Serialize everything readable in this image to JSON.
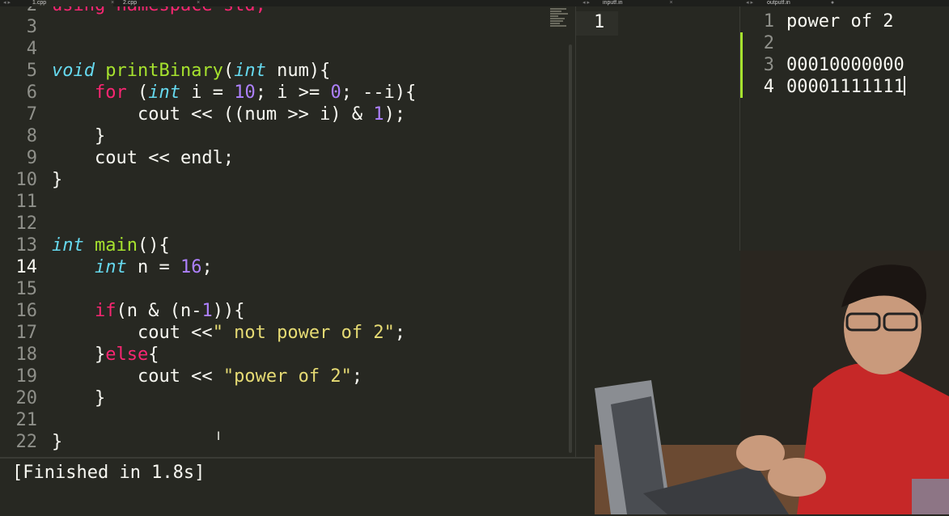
{
  "tabs": {
    "main": [
      {
        "label": "1.cpp",
        "active": true
      },
      {
        "label": "2.cpp",
        "active": false
      }
    ],
    "input": {
      "label": "inputf.in"
    },
    "output": {
      "label": "outputf.in"
    }
  },
  "editor": {
    "lines": [
      {
        "n": "2",
        "tokens": [
          {
            "t": "using namespace std;",
            "c": "kw-partial"
          }
        ]
      },
      {
        "n": "3",
        "tokens": []
      },
      {
        "n": "4",
        "tokens": []
      },
      {
        "n": "5",
        "tokens": [
          {
            "t": "void",
            "c": "ty"
          },
          {
            "t": " "
          },
          {
            "t": "printBinary",
            "c": "fn"
          },
          {
            "t": "("
          },
          {
            "t": "int",
            "c": "ty"
          },
          {
            "t": " num){"
          }
        ]
      },
      {
        "n": "6",
        "tokens": [
          {
            "t": "    "
          },
          {
            "t": "for",
            "c": "kw"
          },
          {
            "t": " ("
          },
          {
            "t": "int",
            "c": "ty"
          },
          {
            "t": " i = "
          },
          {
            "t": "10",
            "c": "num"
          },
          {
            "t": "; i >= "
          },
          {
            "t": "0",
            "c": "num"
          },
          {
            "t": "; --i){"
          }
        ]
      },
      {
        "n": "7",
        "tokens": [
          {
            "t": "        cout << ((num >> i) & "
          },
          {
            "t": "1",
            "c": "num"
          },
          {
            "t": ");"
          }
        ]
      },
      {
        "n": "8",
        "tokens": [
          {
            "t": "    }"
          }
        ]
      },
      {
        "n": "9",
        "tokens": [
          {
            "t": "    cout << endl;"
          }
        ]
      },
      {
        "n": "10",
        "tokens": [
          {
            "t": "}"
          }
        ]
      },
      {
        "n": "11",
        "tokens": []
      },
      {
        "n": "12",
        "tokens": []
      },
      {
        "n": "13",
        "tokens": [
          {
            "t": "int",
            "c": "ty"
          },
          {
            "t": " "
          },
          {
            "t": "main",
            "c": "fn"
          },
          {
            "t": "(){"
          }
        ]
      },
      {
        "n": "14",
        "tokens": [
          {
            "t": "    "
          },
          {
            "t": "int",
            "c": "ty"
          },
          {
            "t": " n = "
          },
          {
            "t": "16",
            "c": "num"
          },
          {
            "t": ";"
          }
        ],
        "current": true
      },
      {
        "n": "15",
        "tokens": []
      },
      {
        "n": "16",
        "tokens": [
          {
            "t": "    "
          },
          {
            "t": "if",
            "c": "kw"
          },
          {
            "t": "(n & (n-"
          },
          {
            "t": "1",
            "c": "num"
          },
          {
            "t": ")){"
          }
        ]
      },
      {
        "n": "17",
        "tokens": [
          {
            "t": "        cout <<"
          },
          {
            "t": "\" not power of 2\"",
            "c": "str"
          },
          {
            "t": ";"
          }
        ]
      },
      {
        "n": "18",
        "tokens": [
          {
            "t": "    }"
          },
          {
            "t": "else",
            "c": "kw"
          },
          {
            "t": "{"
          }
        ]
      },
      {
        "n": "19",
        "tokens": [
          {
            "t": "        cout << "
          },
          {
            "t": "\"power of 2\"",
            "c": "str"
          },
          {
            "t": ";"
          }
        ]
      },
      {
        "n": "20",
        "tokens": [
          {
            "t": "    }"
          }
        ]
      },
      {
        "n": "21",
        "tokens": []
      },
      {
        "n": "22",
        "tokens": [
          {
            "t": "}"
          }
        ]
      }
    ]
  },
  "build_output": {
    "text": "[Finished in 1.8s]"
  },
  "input_pane": {
    "lines": [
      {
        "n": "1",
        "text": ""
      }
    ]
  },
  "output_pane": {
    "lines": [
      {
        "n": "1",
        "text": "power of 2"
      },
      {
        "n": "2",
        "text": ""
      },
      {
        "n": "3",
        "text": "00010000000"
      },
      {
        "n": "4",
        "text": "00001111111",
        "current": true
      }
    ]
  },
  "colors": {
    "background": "#272822",
    "keyword": "#f92672",
    "type": "#66d9ef",
    "function": "#a6e22e",
    "number": "#ae81ff",
    "string": "#e6db74",
    "text": "#f8f8f2",
    "line_number": "#8f908a",
    "git_added": "#a6e22e"
  }
}
